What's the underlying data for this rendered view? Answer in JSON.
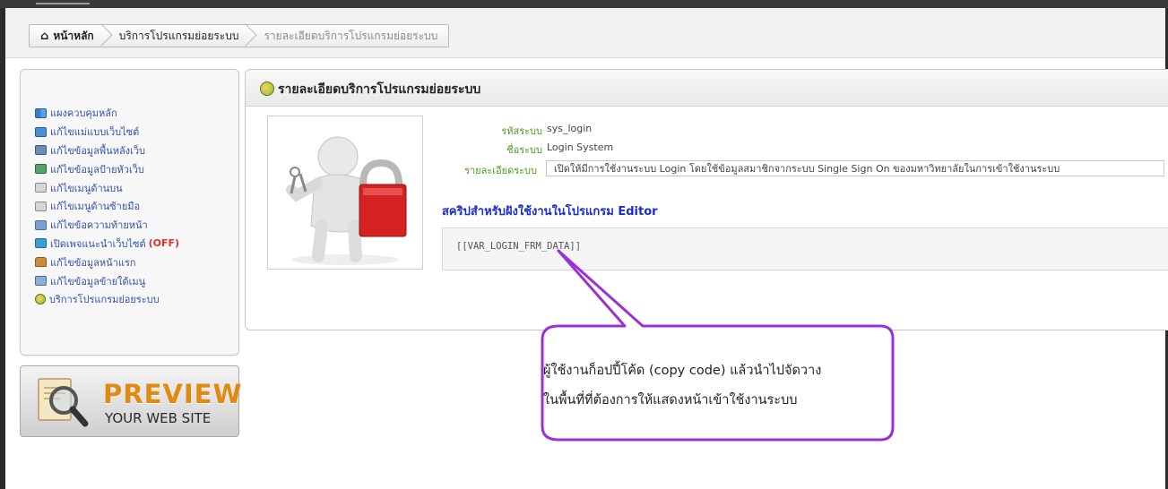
{
  "breadcrumb": {
    "home": "หน้าหลัก",
    "section": "บริการโปรแกรมย่อยระบบ",
    "current": "รายละเอียดบริการโปรแกรมย่อยระบบ"
  },
  "sidebar": {
    "items": [
      {
        "label": "แผงควบคุมหลัก",
        "icon": "dashboard-icon"
      },
      {
        "label": "แก้ไขแม่แบบเว็บไซต์",
        "icon": "template-icon"
      },
      {
        "label": "แก้ไขข้อมูลพื้นหลังเว็บ",
        "icon": "background-icon"
      },
      {
        "label": "แก้ไขข้อมูลป้ายหัวเว็บ",
        "icon": "banner-icon"
      },
      {
        "label": "แก้ไขเมนูด้านบน",
        "icon": "top-menu-icon"
      },
      {
        "label": "แก้ไขเมนูด้านซ้ายมือ",
        "icon": "left-menu-icon"
      },
      {
        "label": "แก้ไขข้อความท้ายหน้า",
        "icon": "footer-icon"
      },
      {
        "label": "เปิดเพจแนะนำเว็บไซต์",
        "status": "(OFF)",
        "icon": "intro-page-icon"
      },
      {
        "label": "แก้ไขข้อมูลหน้าแรก",
        "icon": "home-page-icon"
      },
      {
        "label": "แก้ไขข้อมูลข้ายใต้เมนู",
        "icon": "under-menu-icon"
      },
      {
        "label": "บริการโปรแกรมย่อยระบบ",
        "icon": "service-icon"
      }
    ]
  },
  "preview": {
    "title": "PREVIEW",
    "subtitle": "YOUR WEB SITE"
  },
  "panel": {
    "title": "รายละเอียดบริการโปรแกรมย่อยระบบ",
    "fields": {
      "code_label": "รหัสระบบ",
      "code_value": "sys_login",
      "name_label": "ชื่อระบบ",
      "name_value": "Login System",
      "desc_label": "รายละเอียดระบบ",
      "desc_value": "เปิดให้มีการใช้งานระบบ Login โดยใช้ข้อมูลสมาชิกจากระบบ Single Sign On ของมหาวิทยาลัยในการเข้าใช้งานระบบ"
    },
    "script_heading": "สคริปสำหรับฝังใช้งานในโปรแกรม Editor",
    "code": "[[VAR_LOGIN_FRM_DATA]]"
  },
  "callout": {
    "line1": "ผู้ใช้งานก็อปปี้โค้ด (copy code) แล้วนำไปจัดวาง",
    "line2": "ในพื้นที่ที่ต้องการให้แสดงหน้าเข้าใช้งานระบบ"
  },
  "colors": {
    "link": "#3352a8",
    "label_green": "#4a9a20",
    "heading_blue": "#1a2ed0",
    "callout_border": "#9b30d8",
    "preview_orange": "#e08a12",
    "off_red": "#e03030"
  }
}
